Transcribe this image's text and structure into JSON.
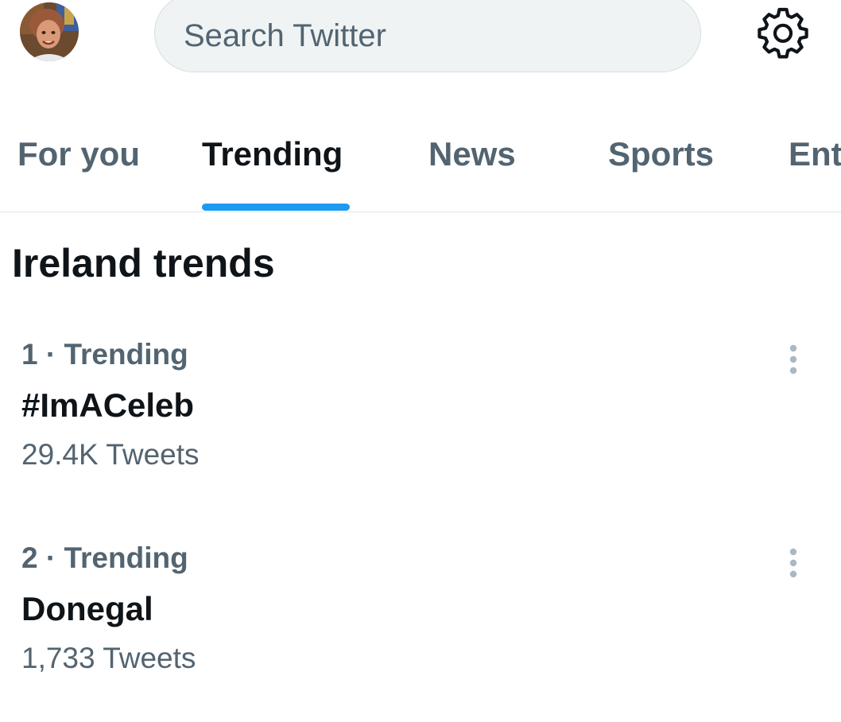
{
  "header": {
    "search_placeholder": "Search Twitter",
    "avatar_icon": "user-avatar-photo",
    "settings_icon": "gear-icon"
  },
  "tabs": [
    {
      "label": "For you",
      "active": false
    },
    {
      "label": "Trending",
      "active": true
    },
    {
      "label": "News",
      "active": false
    },
    {
      "label": "Sports",
      "active": false
    },
    {
      "label": "Ent",
      "active": false
    }
  ],
  "section": {
    "title": "Ireland trends"
  },
  "trends": [
    {
      "meta": "1 · Trending",
      "name": "#ImACeleb",
      "count": "29.4K Tweets"
    },
    {
      "meta": "2 · Trending",
      "name": "Donegal",
      "count": "1,733 Tweets"
    }
  ],
  "colors": {
    "accent": "#1d9bf0",
    "primary_text": "#0f1419",
    "secondary_text": "#536471",
    "search_bg": "#eff3f4",
    "more_dots": "#aab8c2"
  }
}
